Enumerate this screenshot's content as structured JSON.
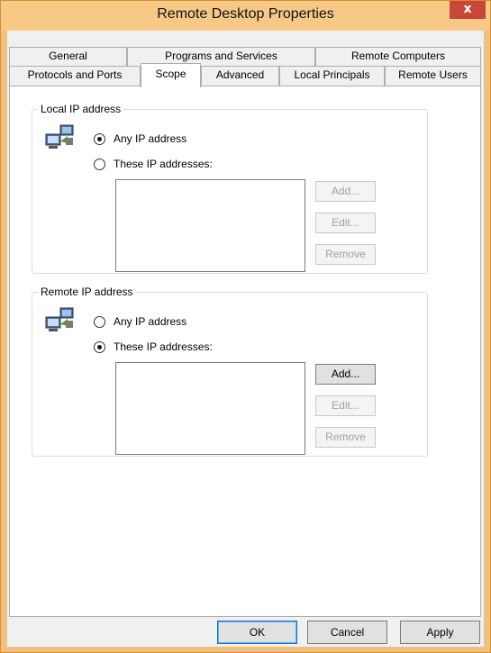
{
  "window": {
    "title": "Remote Desktop Properties",
    "close_glyph": "x"
  },
  "tabs": {
    "row1": [
      "General",
      "Programs and Services",
      "Remote Computers"
    ],
    "row2": [
      "Protocols and Ports",
      "Scope",
      "Advanced",
      "Local Principals",
      "Remote Users"
    ],
    "active": "Scope"
  },
  "local": {
    "label": "Local IP address",
    "icon": "network-computers-icon",
    "any_label": "Any IP address",
    "these_label": "These IP addresses:",
    "selected": "any",
    "buttons": {
      "add": "Add...",
      "edit": "Edit...",
      "remove": "Remove"
    }
  },
  "remote": {
    "label": "Remote IP address",
    "icon": "network-computers-icon",
    "any_label": "Any IP address",
    "these_label": "These IP addresses:",
    "selected": "these",
    "buttons": {
      "add": "Add...",
      "edit": "Edit...",
      "remove": "Remove"
    }
  },
  "footer": {
    "ok": "OK",
    "cancel": "Cancel",
    "apply": "Apply"
  },
  "colors": {
    "title_bar": "#f6c987",
    "close_button": "#c7483a",
    "panel": "#ffffff"
  }
}
